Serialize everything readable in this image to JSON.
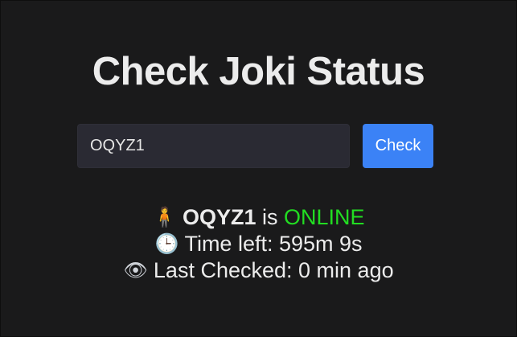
{
  "page": {
    "title": "Check Joki Status"
  },
  "search": {
    "value": "OQYZ1",
    "button_label": "Check"
  },
  "status": {
    "username": "OQYZ1",
    "connector": "is",
    "state": "ONLINE",
    "time_left_label": "Time left:",
    "time_left_value": "595m 9s",
    "last_checked_label": "Last Checked:",
    "last_checked_value": "0 min ago",
    "icons": [
      "person-icon",
      "clock-icon",
      "eye-icon"
    ]
  },
  "colors": {
    "background": "#1a1a1b",
    "button": "#3b82f6",
    "online": "#22dd22"
  }
}
